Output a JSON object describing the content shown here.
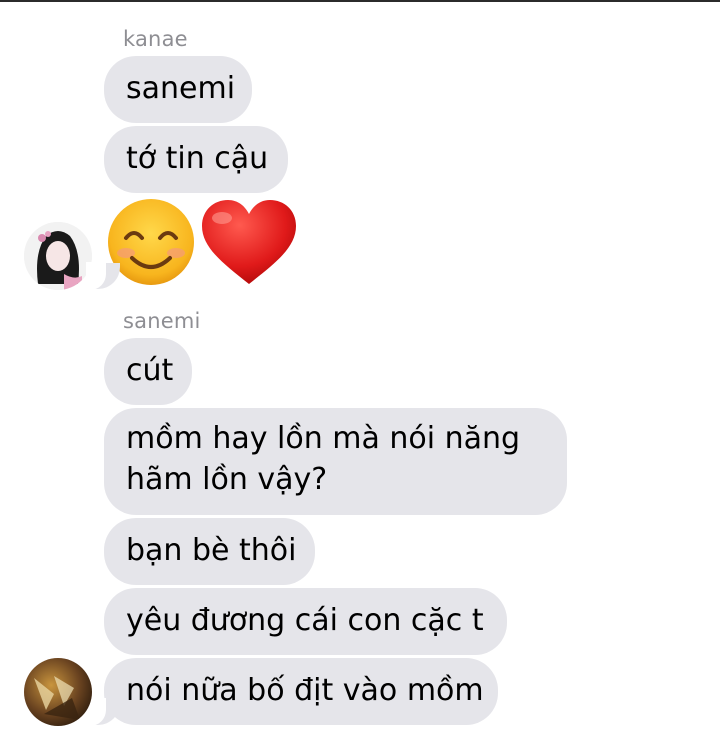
{
  "conversation": {
    "groups": [
      {
        "sender": "kanae",
        "messages": [
          "sanemi",
          "tớ tin cậu"
        ],
        "emoji": [
          "smiling-face-with-smiling-eyes",
          "red-heart"
        ],
        "avatar": "kanae-avatar"
      },
      {
        "sender": "sanemi",
        "messages": [
          "cút",
          "mồm hay lồn mà nói năng\nhãm lồn vậy?",
          "bạn bè thôi",
          "yêu đương cái con cặc t",
          "nói nữa bố địt vào mồm"
        ],
        "avatar": "sanemi-avatar"
      }
    ]
  },
  "colors": {
    "incoming_bubble": "#e5e5ea",
    "sender_name": "#8e8e93",
    "background": "#ffffff"
  }
}
